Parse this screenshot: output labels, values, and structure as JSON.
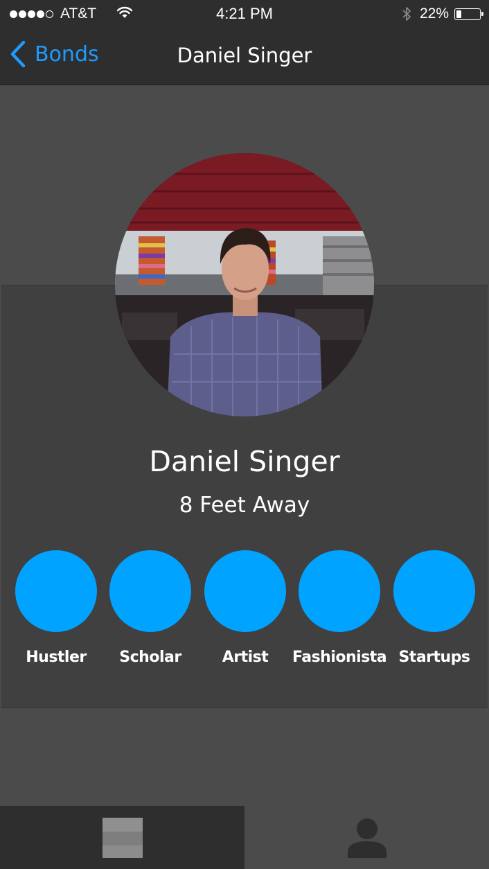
{
  "status_bar": {
    "carrier": "AT&T",
    "time": "4:21 PM",
    "battery_percent": "22%",
    "battery_level": 0.22,
    "signal_bars_filled": 4,
    "signal_bars_total": 5
  },
  "nav": {
    "back_label": "Bonds",
    "title": "Daniel Singer"
  },
  "profile": {
    "name": "Daniel Singer",
    "distance": "8 Feet Away"
  },
  "traits": [
    {
      "label": "Hustler"
    },
    {
      "label": "Scholar"
    },
    {
      "label": "Artist"
    },
    {
      "label": "Fashionista"
    },
    {
      "label": "Startups"
    }
  ],
  "tabs": [
    {
      "icon": "stack-icon",
      "selected": true
    },
    {
      "icon": "person-icon",
      "selected": false
    }
  ],
  "colors": {
    "accent": "#1e9bff",
    "trait_circle": "#00a3ff",
    "bar_background": "#2e2e2e",
    "card_background": "#404040"
  }
}
